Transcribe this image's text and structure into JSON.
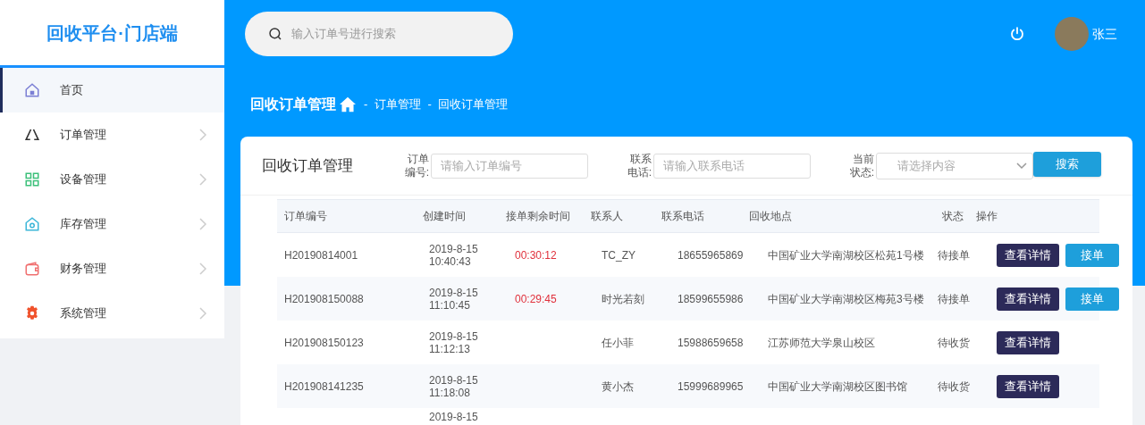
{
  "logo": "回收平台·门店端",
  "sidebar": {
    "items": [
      {
        "label": "首页",
        "selected": true,
        "has_arrow": false
      },
      {
        "label": "订单管理",
        "selected": false,
        "has_arrow": true
      },
      {
        "label": "设备管理",
        "selected": false,
        "has_arrow": true
      },
      {
        "label": "库存管理",
        "selected": false,
        "has_arrow": true
      },
      {
        "label": "财务管理",
        "selected": false,
        "has_arrow": true
      },
      {
        "label": "系统管理",
        "selected": false,
        "has_arrow": true
      }
    ]
  },
  "topbar": {
    "search_placeholder": "输入订单号进行搜索",
    "user": "张三"
  },
  "breadcrumb": {
    "title": "回收订单管理",
    "path": [
      "-  订单管理",
      "-  回收订单管理"
    ]
  },
  "card": {
    "title": "回收订单管理",
    "filters": [
      {
        "kind": "input",
        "label": "订单编号:",
        "placeholder": "请输入订单编号"
      },
      {
        "kind": "input",
        "label": "联系电话:",
        "placeholder": "请输入联系电话"
      },
      {
        "kind": "select",
        "label": "当前状态:",
        "placeholder": "请选择内容"
      }
    ],
    "search_button": "搜索",
    "table": {
      "columns": [
        "订单编号",
        "创建时间",
        "接单剩余时间",
        "联系人",
        "联系电话",
        "回收地点",
        "状态",
        "操作"
      ],
      "rows": [
        {
          "order_no": "H20190814001",
          "created_date": "2019-8-15",
          "created_time": "10:40:43",
          "remaining": "00:30:12",
          "contact": "TC_ZY",
          "phone": "18655965869",
          "address": "中国矿业大学南湖校区松苑1号楼",
          "status": "待接单",
          "actions": [
            "查看详情",
            "接单"
          ]
        },
        {
          "order_no": "H201908150088",
          "created_date": "2019-8-15",
          "created_time": "11:10:45",
          "remaining": "00:29:45",
          "contact": "时光若刻",
          "phone": "18599655986",
          "address": "中国矿业大学南湖校区梅苑3号楼",
          "status": "待接单",
          "actions": [
            "查看详情",
            "接单"
          ]
        },
        {
          "order_no": "H201908150123",
          "created_date": "2019-8-15",
          "created_time": "11:12:13",
          "remaining": "",
          "contact": "任小菲",
          "phone": "15988659658",
          "address": "江苏师范大学泉山校区",
          "status": "待收货",
          "actions": [
            "查看详情"
          ]
        },
        {
          "order_no": "H201908141235",
          "created_date": "2019-8-15",
          "created_time": "11:18:08",
          "remaining": "",
          "contact": "黄小杰",
          "phone": "15999689965",
          "address": "中国矿业大学南湖校区图书馆",
          "status": "待收货",
          "actions": [
            "查看详情"
          ]
        },
        {
          "order_no": "",
          "created_date": "2019-8-15",
          "created_time": "",
          "remaining": "",
          "contact": "",
          "phone": "",
          "address": "",
          "status": "",
          "actions": []
        }
      ]
    }
  }
}
